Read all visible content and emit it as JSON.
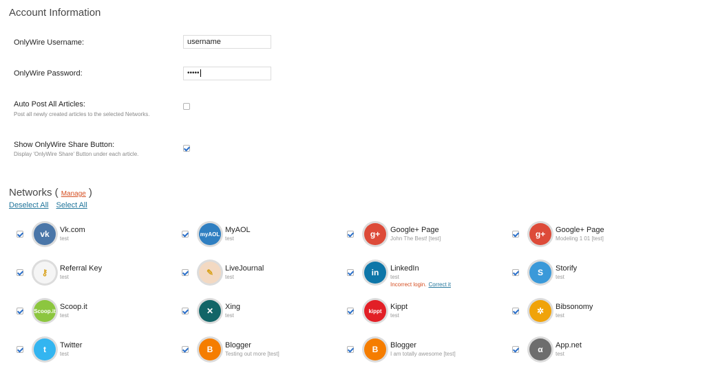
{
  "account": {
    "title": "Account Information",
    "username_label": "OnlyWire Username:",
    "username_value": "username",
    "password_label": "OnlyWire Password:",
    "password_mask": "•••••",
    "autopost_label": "Auto Post All Articles:",
    "autopost_desc": "Post all newly created articles to the selected Networks.",
    "autopost_checked": false,
    "share_label": "Show OnlyWire Share Button:",
    "share_desc": "Display 'OnlyWire Share' Button under each article.",
    "share_checked": true
  },
  "networks": {
    "title": "Networks (",
    "title_close": ")",
    "manage_label": "Manage",
    "deselect_all": "Deselect All",
    "select_all": "Select All",
    "items": [
      {
        "name": "Vk.com",
        "sub": "test",
        "icon": "vk-icon",
        "color": "#4a76a8",
        "glyph": "vk",
        "checked": true
      },
      {
        "name": "MyAOL",
        "sub": "test",
        "icon": "aol-icon",
        "color": "#2f7fc1",
        "glyph": "myAOL",
        "checked": true
      },
      {
        "name": "Google+ Page",
        "sub": "John The Best! [test]",
        "icon": "google-plus-icon",
        "color": "#dd4b39",
        "glyph": "g+",
        "checked": true
      },
      {
        "name": "Google+ Page",
        "sub": "Modeling 1 01 [test]",
        "icon": "google-plus-icon",
        "color": "#dd4b39",
        "glyph": "g+",
        "checked": true
      },
      {
        "name": "Referral Key",
        "sub": "test",
        "icon": "referral-key-icon",
        "color": "#f5f5f5",
        "glyph": "⚷",
        "checked": true
      },
      {
        "name": "LiveJournal",
        "sub": "test",
        "icon": "livejournal-icon",
        "color": "#f3d9c2",
        "glyph": "✎",
        "checked": true
      },
      {
        "name": "LinkedIn",
        "sub": "test",
        "icon": "linkedin-icon",
        "color": "#0e76a8",
        "glyph": "in",
        "checked": true,
        "error": "Incorrect login.",
        "fix": "Correct it"
      },
      {
        "name": "Storify",
        "sub": "test",
        "icon": "storify-icon",
        "color": "#3a99d9",
        "glyph": "S",
        "checked": true
      },
      {
        "name": "Scoop.it",
        "sub": "test",
        "icon": "scoopit-icon",
        "color": "#8cc63f",
        "glyph": "Scoop.it",
        "checked": true
      },
      {
        "name": "Xing",
        "sub": "test",
        "icon": "xing-icon",
        "color": "#126567",
        "glyph": "✕",
        "checked": true
      },
      {
        "name": "Kippt",
        "sub": "test",
        "icon": "kippt-icon",
        "color": "#e21f26",
        "glyph": "kippt",
        "checked": true
      },
      {
        "name": "Bibsonomy",
        "sub": "test",
        "icon": "bibsonomy-icon",
        "color": "#f0a30a",
        "glyph": "✲",
        "checked": true
      },
      {
        "name": "Twitter",
        "sub": "test",
        "icon": "twitter-icon",
        "color": "#33b5f0",
        "glyph": "t",
        "checked": true
      },
      {
        "name": "Blogger",
        "sub": "Testing out more [test]",
        "icon": "blogger-icon",
        "color": "#f57d00",
        "glyph": "B",
        "checked": true
      },
      {
        "name": "Blogger",
        "sub": "I am totally awesome [test]",
        "icon": "blogger-icon",
        "color": "#f57d00",
        "glyph": "B",
        "checked": true
      },
      {
        "name": "App.net",
        "sub": "test",
        "icon": "appnet-icon",
        "color": "#6d6d6d",
        "glyph": "α",
        "checked": true
      }
    ]
  }
}
